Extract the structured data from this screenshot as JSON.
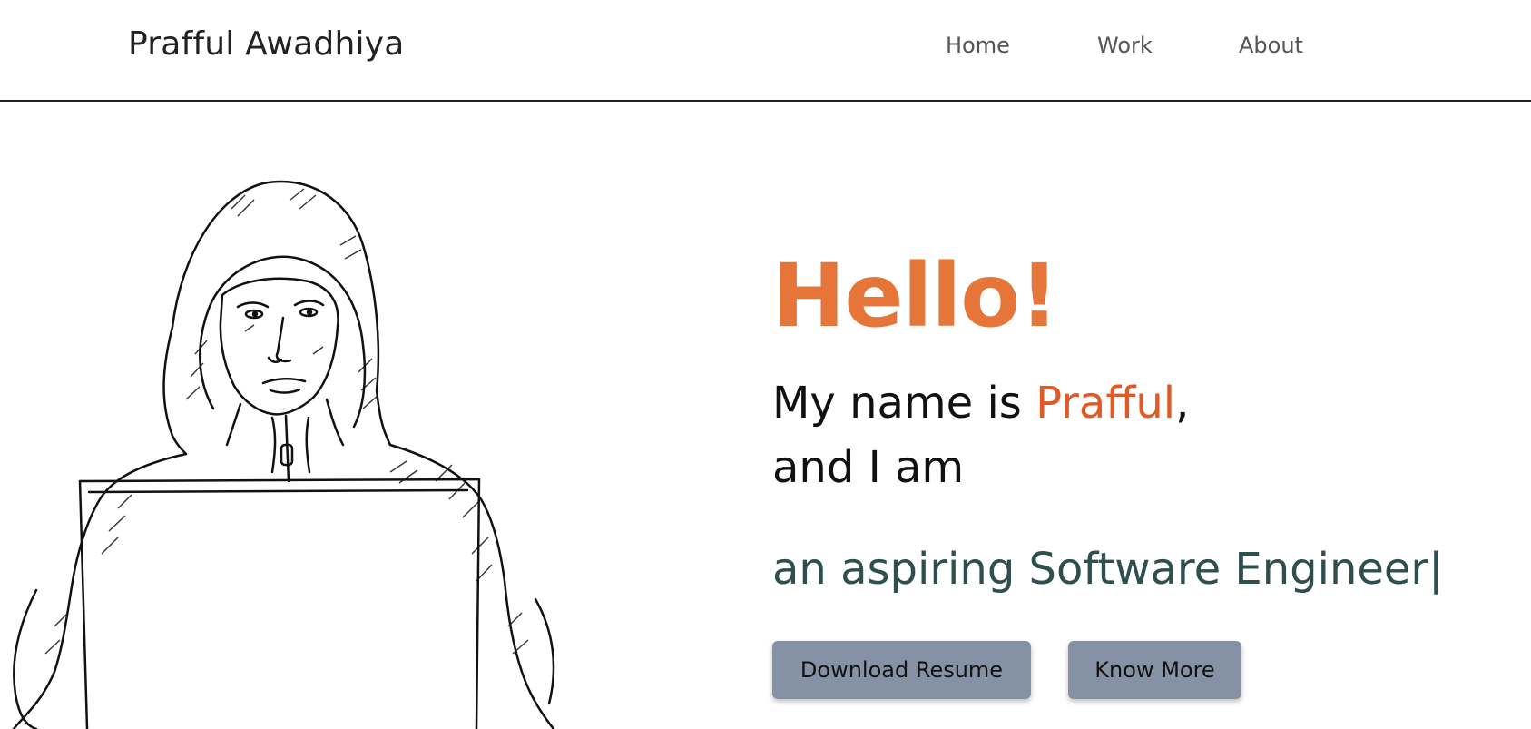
{
  "header": {
    "brand": "Prafful Awadhiya",
    "nav": [
      {
        "label": "Home"
      },
      {
        "label": "Work"
      },
      {
        "label": "About"
      }
    ]
  },
  "hero": {
    "greeting": "Hello!",
    "intro_prefix": "My name is ",
    "intro_name": "Prafful",
    "intro_suffix": ",",
    "intro_line2": "and I am",
    "typed_text": "an aspiring Software Engineer",
    "caret": "|"
  },
  "buttons": {
    "download_resume": "Download Resume",
    "know_more": "Know More"
  },
  "colors": {
    "accent_orange": "#e6753a",
    "name_orange": "#e05a28",
    "typed_text": "#2f4f4f",
    "button_bg": "#8592a6"
  },
  "illustration": {
    "subject": "hoodie-person-laptop-sketch"
  }
}
